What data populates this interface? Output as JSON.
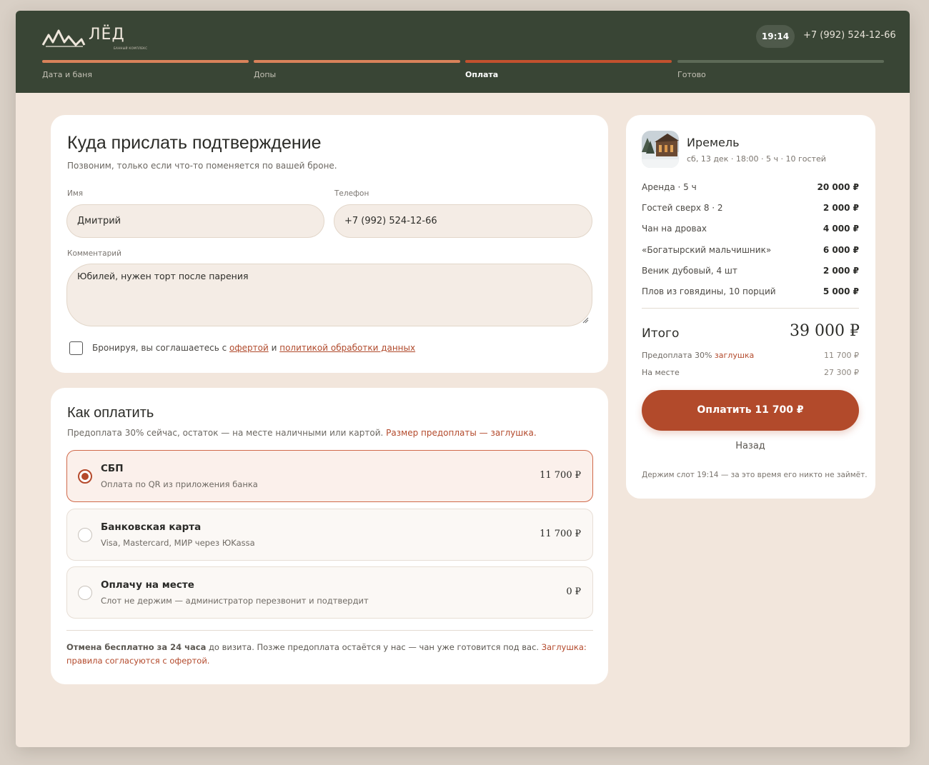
{
  "header": {
    "logo_text": "ЛЁД",
    "logo_subtitle": "БАННЫЙ КОМПЛЕКС",
    "time": "19:14",
    "phone": "+7 (992) 524-12-66",
    "steps": [
      {
        "label": "Дата и баня",
        "color": "#d9825a"
      },
      {
        "label": "Допы",
        "color": "#d9825a"
      },
      {
        "label": "Оплата",
        "color": "#c2512e"
      },
      {
        "label": "Готово",
        "color": "#5d6a57"
      }
    ]
  },
  "contact": {
    "title": "Куда прислать подтверждение",
    "subtitle": "Позвоним, только если что-то поменяется по вашей броне.",
    "name_label": "Имя",
    "name_value": "Дмитрий",
    "phone_label": "Телефон",
    "phone_value": "+7 (992) 524-12-66",
    "comment_label": "Комментарий",
    "comment_value": "Юбилей, нужен торт после парения",
    "agree_prefix": "Бронируя, вы соглашаетесь с",
    "agree_offer": "офертой",
    "agree_and": "и",
    "agree_policy": "политикой обработки данных"
  },
  "payment": {
    "title": "Как оплатить",
    "subtitle": "Предоплата 30% сейчас, остаток — на месте наличными или картой.",
    "subtitle_accent": "Размер предоплаты — заглушка.",
    "options": [
      {
        "title": "СБП",
        "desc": "Оплата по QR из приложения банка",
        "price": "11 700 ₽",
        "selected": true
      },
      {
        "title": "Банковская карта",
        "desc": "Visa, Mastercard, МИР через ЮKassa",
        "price": "11 700 ₽",
        "selected": false
      },
      {
        "title": "Оплачу на месте",
        "desc": "Слот не держим — администратор перезвонит и подтвердит",
        "price": "0 ₽",
        "selected": false
      }
    ],
    "note_bold": "Отмена бесплатно за 24 часа",
    "note_text": "до визита. Позже предоплата остаётся у нас — чан уже готовится под вас.",
    "note_accent": "Заглушка: правила согласуются с офертой."
  },
  "summary": {
    "place": "Иремель",
    "details": "сб, 13 дек · 18:00 · 5 ч · 10 гостей",
    "items": [
      {
        "label": "Аренда · 5 ч",
        "amount": "20 000 ₽"
      },
      {
        "label": "Гостей сверх 8 · 2",
        "amount": "2 000 ₽"
      },
      {
        "label": "Чан на дровах",
        "amount": "4 000 ₽"
      },
      {
        "label": "«Богатырский мальчишник»",
        "amount": "6 000 ₽"
      },
      {
        "label": "Веник дубовый, 4 шт",
        "amount": "2 000 ₽"
      },
      {
        "label": "Плов из говядины, 10 порций",
        "amount": "5 000 ₽"
      }
    ],
    "total_label": "Итого",
    "total_value": "39 000 ₽",
    "prepay_label": "Предоплата 30%",
    "prepay_accent": "заглушка",
    "prepay_value": "11 700 ₽",
    "onsite_label": "На месте",
    "onsite_value": "27 300 ₽",
    "pay_button": "Оплатить 11 700 ₽",
    "back": "Назад",
    "hold_note": "Держим слот 19:14 — за это время его никто не займёт."
  }
}
